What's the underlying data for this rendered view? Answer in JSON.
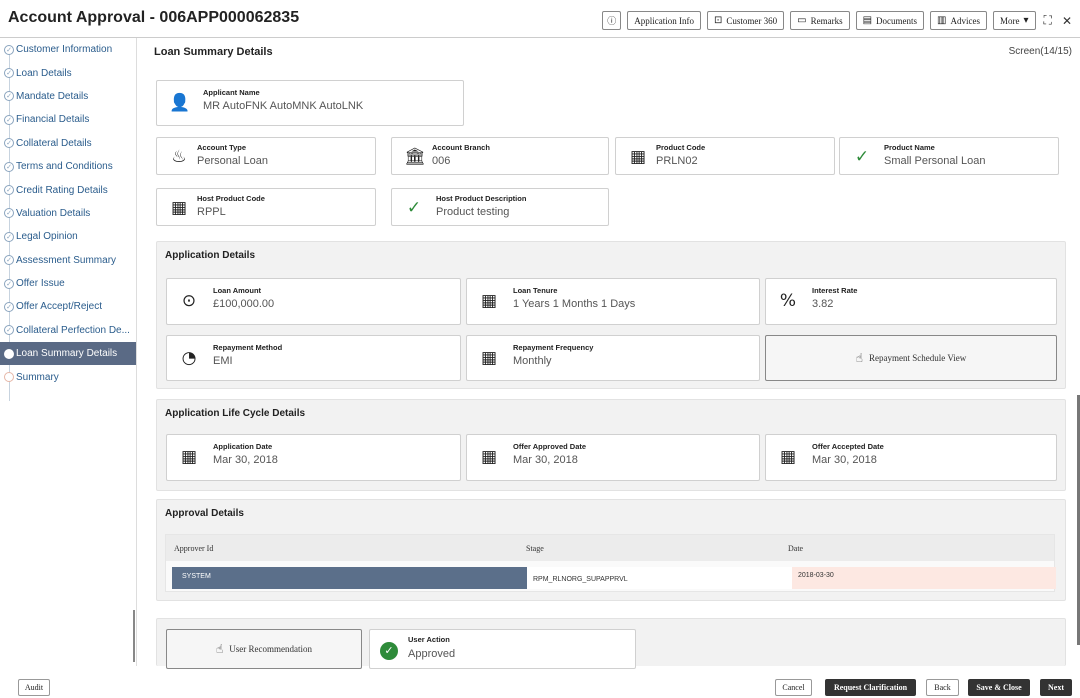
{
  "header": {
    "title": "Account Approval - 006APP000062835",
    "buttons": {
      "info_icon": "info-icon",
      "application_info": "Application Info",
      "customer_360": "Customer 360",
      "remarks": "Remarks",
      "documents": "Documents",
      "advices": "Advices",
      "more": "More"
    }
  },
  "sidebar": {
    "items": [
      {
        "label": "Customer Information"
      },
      {
        "label": "Loan Details"
      },
      {
        "label": "Mandate Details"
      },
      {
        "label": "Financial Details"
      },
      {
        "label": "Collateral Details"
      },
      {
        "label": "Terms and Conditions"
      },
      {
        "label": "Credit Rating Details"
      },
      {
        "label": "Valuation Details"
      },
      {
        "label": "Legal Opinion"
      },
      {
        "label": "Assessment Summary"
      },
      {
        "label": "Offer Issue"
      },
      {
        "label": "Offer Accept/Reject"
      },
      {
        "label": "Collateral Perfection De..."
      },
      {
        "label": "Loan Summary Details"
      },
      {
        "label": "Summary"
      }
    ]
  },
  "main": {
    "title": "Loan Summary Details",
    "screen": "Screen(14/15)",
    "applicant": {
      "label": "Applicant Name",
      "value": "MR AutoFNK AutoMNK AutoLNK"
    },
    "account_type": {
      "label": "Account Type",
      "value": "Personal Loan"
    },
    "account_branch": {
      "label": "Account Branch",
      "value": "006"
    },
    "product_code": {
      "label": "Product Code",
      "value": "PRLN02"
    },
    "product_name": {
      "label": "Product Name",
      "value": "Small Personal Loan"
    },
    "host_product_code": {
      "label": "Host Product Code",
      "value": "RPPL"
    },
    "host_product_desc": {
      "label": "Host Product Description",
      "value": "Product testing"
    }
  },
  "application_details": {
    "title": "Application Details",
    "loan_amount": {
      "label": "Loan Amount",
      "value": "£100,000.00"
    },
    "loan_tenure": {
      "label": "Loan Tenure",
      "value": "1 Years 1 Months 1 Days"
    },
    "interest_rate": {
      "label": "Interest Rate",
      "value": "3.82"
    },
    "repayment_method": {
      "label": "Repayment Method",
      "value": "EMI"
    },
    "repayment_frequency": {
      "label": "Repayment Frequency",
      "value": "Monthly"
    },
    "repayment_schedule": "Repayment Schedule View"
  },
  "lifecycle": {
    "title": "Application Life Cycle Details",
    "application_date": {
      "label": "Application Date",
      "value": "Mar 30, 2018"
    },
    "offer_approved_date": {
      "label": "Offer Approved Date",
      "value": "Mar 30, 2018"
    },
    "offer_accepted_date": {
      "label": "Offer Accepted Date",
      "value": "Mar 30, 2018"
    }
  },
  "approval": {
    "title": "Approval Details",
    "columns": [
      "Approver Id",
      "Stage",
      "Date"
    ],
    "rows": [
      {
        "approver": "SYSTEM",
        "stage": "RPM_RLNORG_SUPAPPRVL",
        "date": "2018-03-30"
      }
    ]
  },
  "recommendation": {
    "button": "User Recommendation",
    "user_action_label": "User Action",
    "user_action_value": "Approved"
  },
  "footer": {
    "audit": "Audit",
    "cancel": "Cancel",
    "request_clarification": "Request Clarification",
    "back": "Back",
    "save_close": "Save & Close",
    "next": "Next"
  }
}
